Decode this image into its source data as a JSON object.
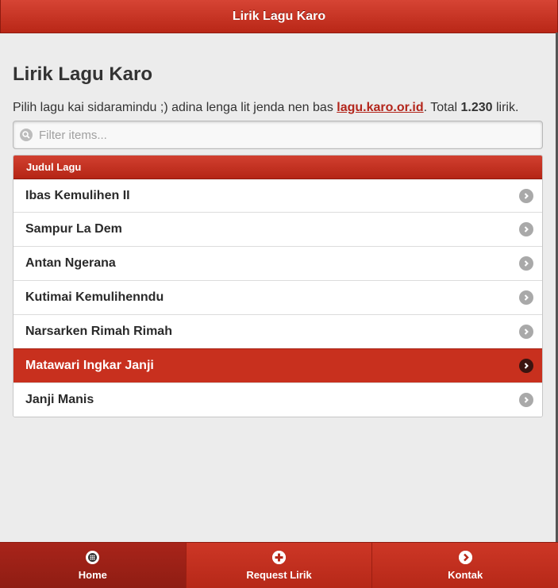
{
  "header": {
    "title": "Lirik Lagu Karo"
  },
  "main": {
    "title": "Lirik Lagu Karo",
    "intro_prefix": "Pilih lagu kai sidaramindu ;) adina lenga lit jenda nen bas ",
    "intro_link": "lagu.karo.or.id",
    "intro_mid": ". Total ",
    "intro_count": "1.230",
    "intro_suffix": " lirik."
  },
  "search": {
    "placeholder": "Filter items...",
    "icon": "search-icon"
  },
  "list": {
    "divider": "Judul Lagu",
    "items": [
      {
        "label": "Ibas Kemulihen II"
      },
      {
        "label": "Sampur La Dem"
      },
      {
        "label": "Antan Ngerana"
      },
      {
        "label": "Kutimai Kemulihenndu"
      },
      {
        "label": "Narsarken Rimah Rimah"
      },
      {
        "label": "Matawari Ingkar Janji"
      },
      {
        "label": "Janji Manis"
      }
    ]
  },
  "footer": {
    "tabs": [
      {
        "label": "Home",
        "icon": "grid-icon"
      },
      {
        "label": "Request Lirik",
        "icon": "plus-icon"
      },
      {
        "label": "Kontak",
        "icon": "chevron-right-icon"
      }
    ]
  },
  "colors": {
    "brand_red": "#c8301e",
    "background": "#ececec",
    "link": "#b3261c"
  }
}
